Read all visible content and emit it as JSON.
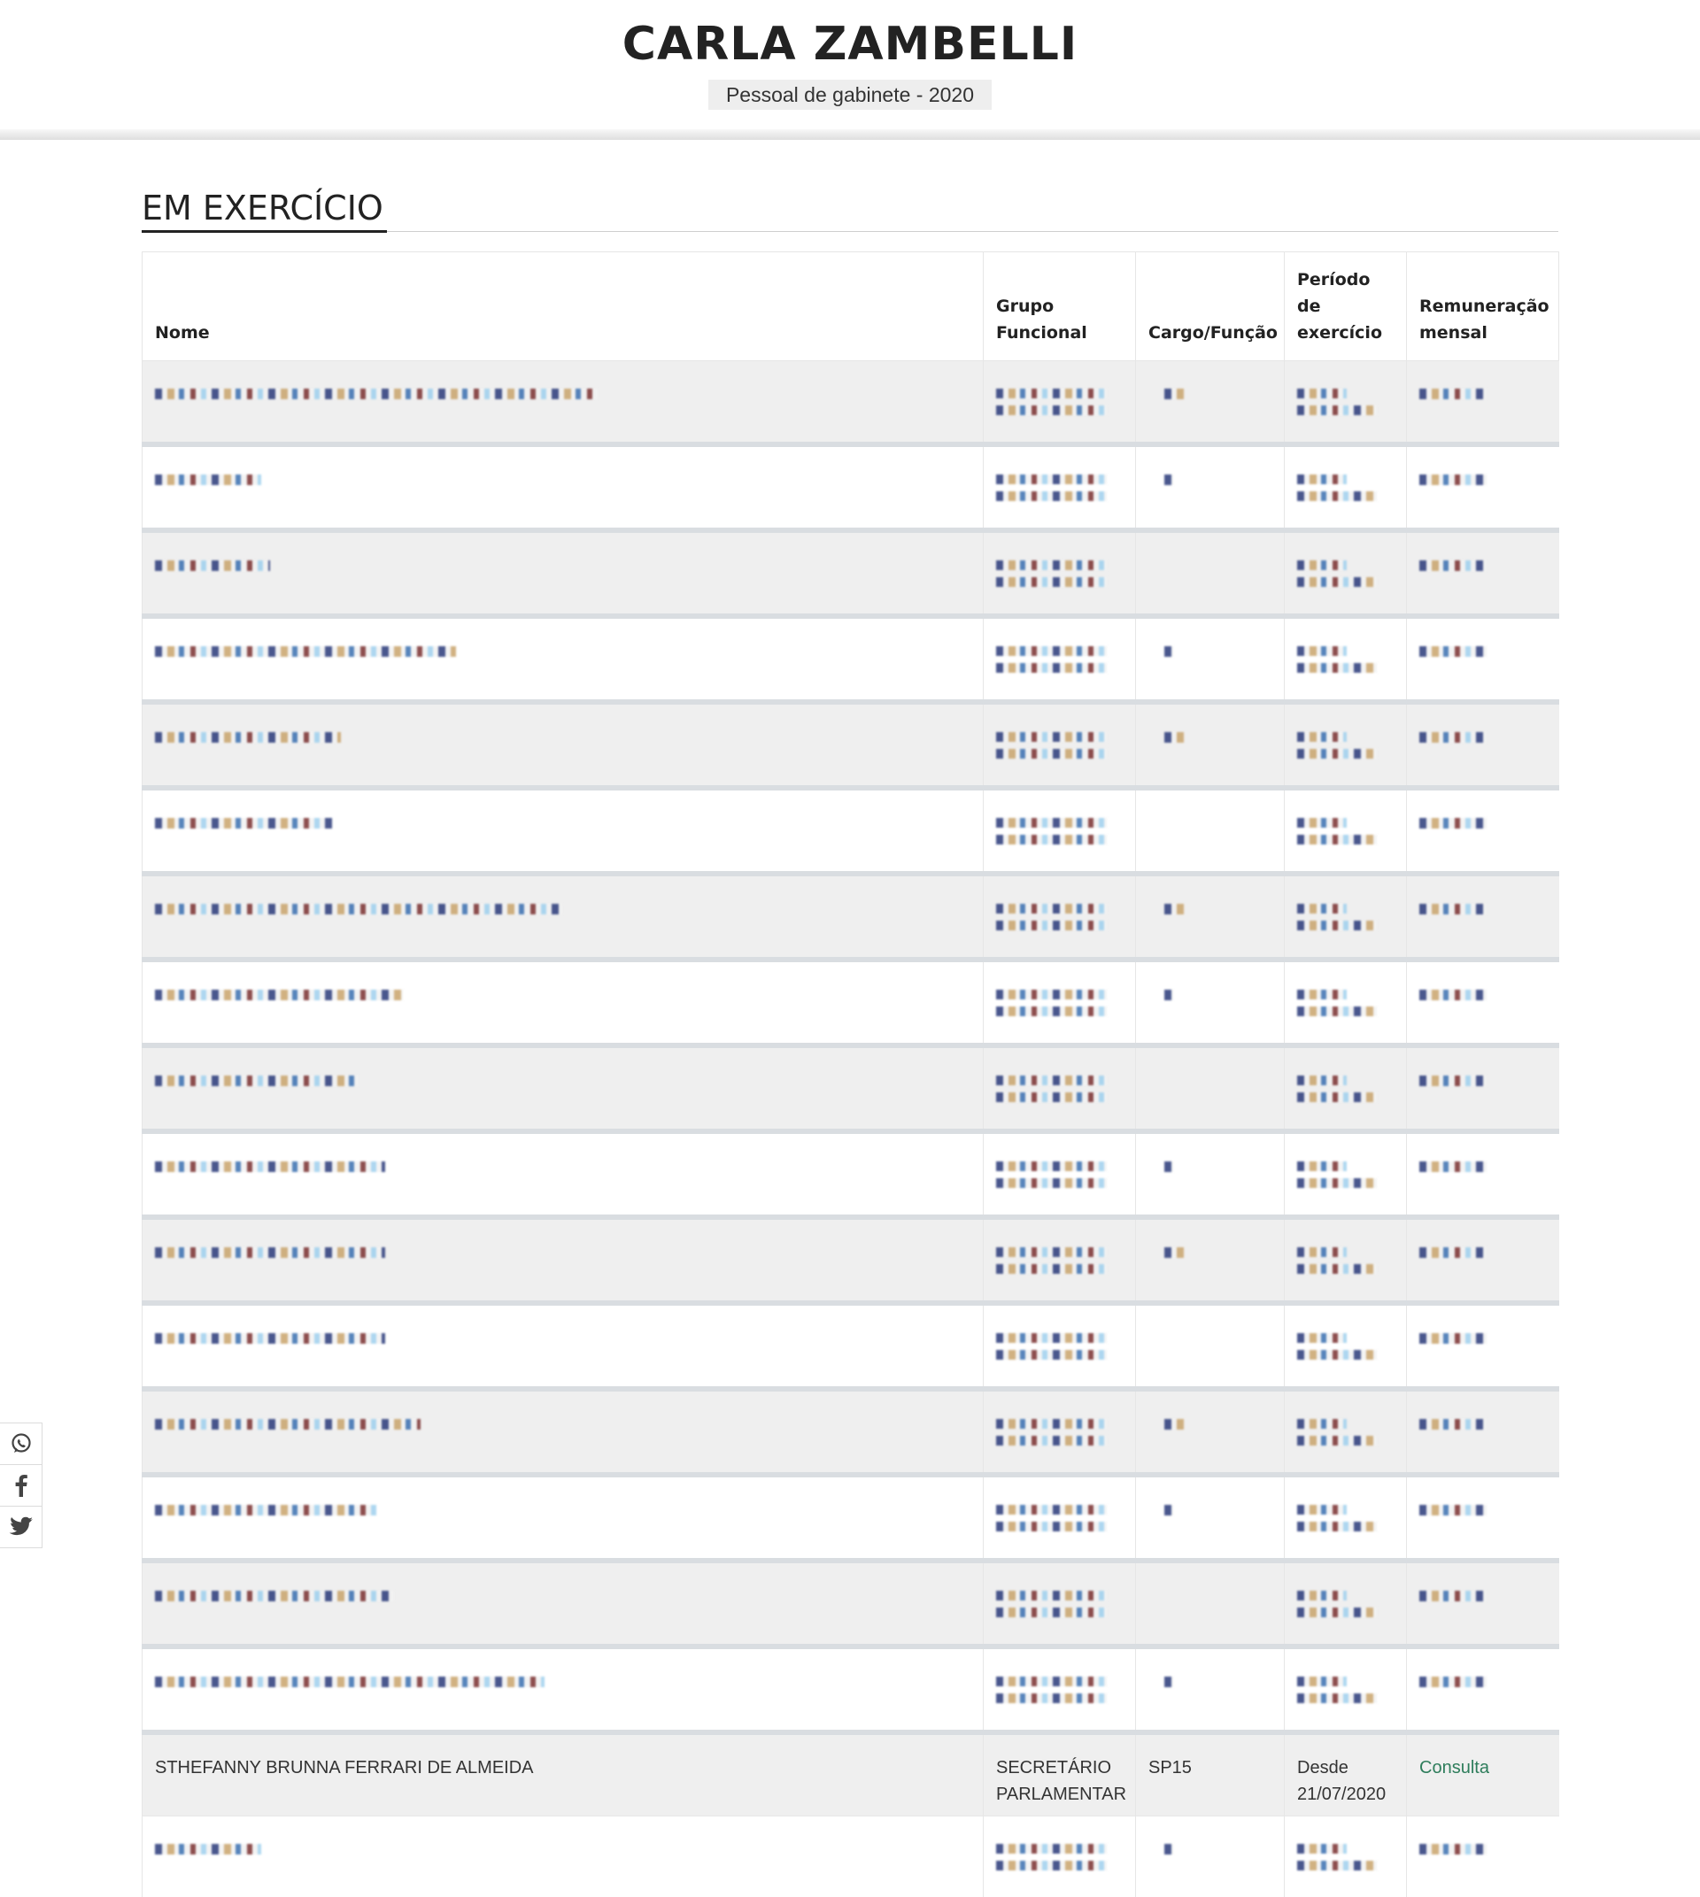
{
  "header": {
    "title": "CARLA ZAMBELLI",
    "subtitle": "Pessoal de gabinete - 2020"
  },
  "section": {
    "title": "EM EXERCÍCIO"
  },
  "table": {
    "columns": [
      "Nome",
      "Grupo Funcional",
      "Cargo/Função",
      "Período de exercício",
      "Remuneração mensal"
    ],
    "visible_row": {
      "name": "STHEFANNY BRUNNA FERRARI DE ALMEIDA",
      "group": "SECRETÁRIO PARLAMENTAR",
      "role": "SP15",
      "period": "Desde 21/07/2020",
      "salary_link": "Consulta"
    },
    "redacted_rows_before": 16,
    "redacted_rows_after": 1
  },
  "share": {
    "icons": [
      "whatsapp-icon",
      "facebook-icon",
      "twitter-icon"
    ]
  },
  "colors": {
    "link": "#2e7d5b",
    "row_alt": "#efefef",
    "row_separator": "#d9dde1"
  }
}
